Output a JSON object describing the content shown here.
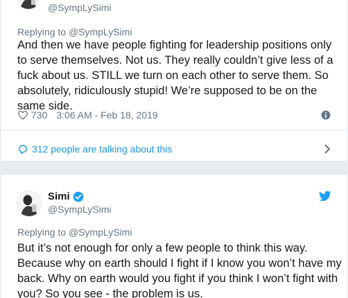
{
  "tweet1": {
    "handle": "@SympLySimi",
    "replying_prefix": "Replying to ",
    "replying_handle": "@SympLySimi",
    "text": "And then we have people fighting for leadership positions only to serve themselves. Not us. They really couldn’t give less of a fuck about us. STILL we turn on each other to serve them. So absolutely, ridiculously stupid! We’re supposed to be on the same side.",
    "likes": "730",
    "timestamp": "3:06 AM - Feb 18, 2019",
    "talking": "312 people are talking about this"
  },
  "tweet2": {
    "name": "Simi",
    "handle": "@SympLySimi",
    "replying_prefix": "Replying to ",
    "replying_handle": "@SympLySimi",
    "text": "But it’s not enough for only a few people to think this way. Because why on earth should I fight if I know you won’t have my back. Why on earth would you fight if you think I won’t fight with you? So you see - the problem is us."
  },
  "colors": {
    "link": "#1b95e0",
    "secondary": "#657786",
    "verified": "#1da1f2",
    "background": "#e6ecf0"
  },
  "icons": [
    "avatar",
    "heart-icon",
    "info-icon",
    "comment-bubble-icon",
    "chevron-right-icon",
    "verified-badge-icon",
    "twitter-bird-icon"
  ]
}
